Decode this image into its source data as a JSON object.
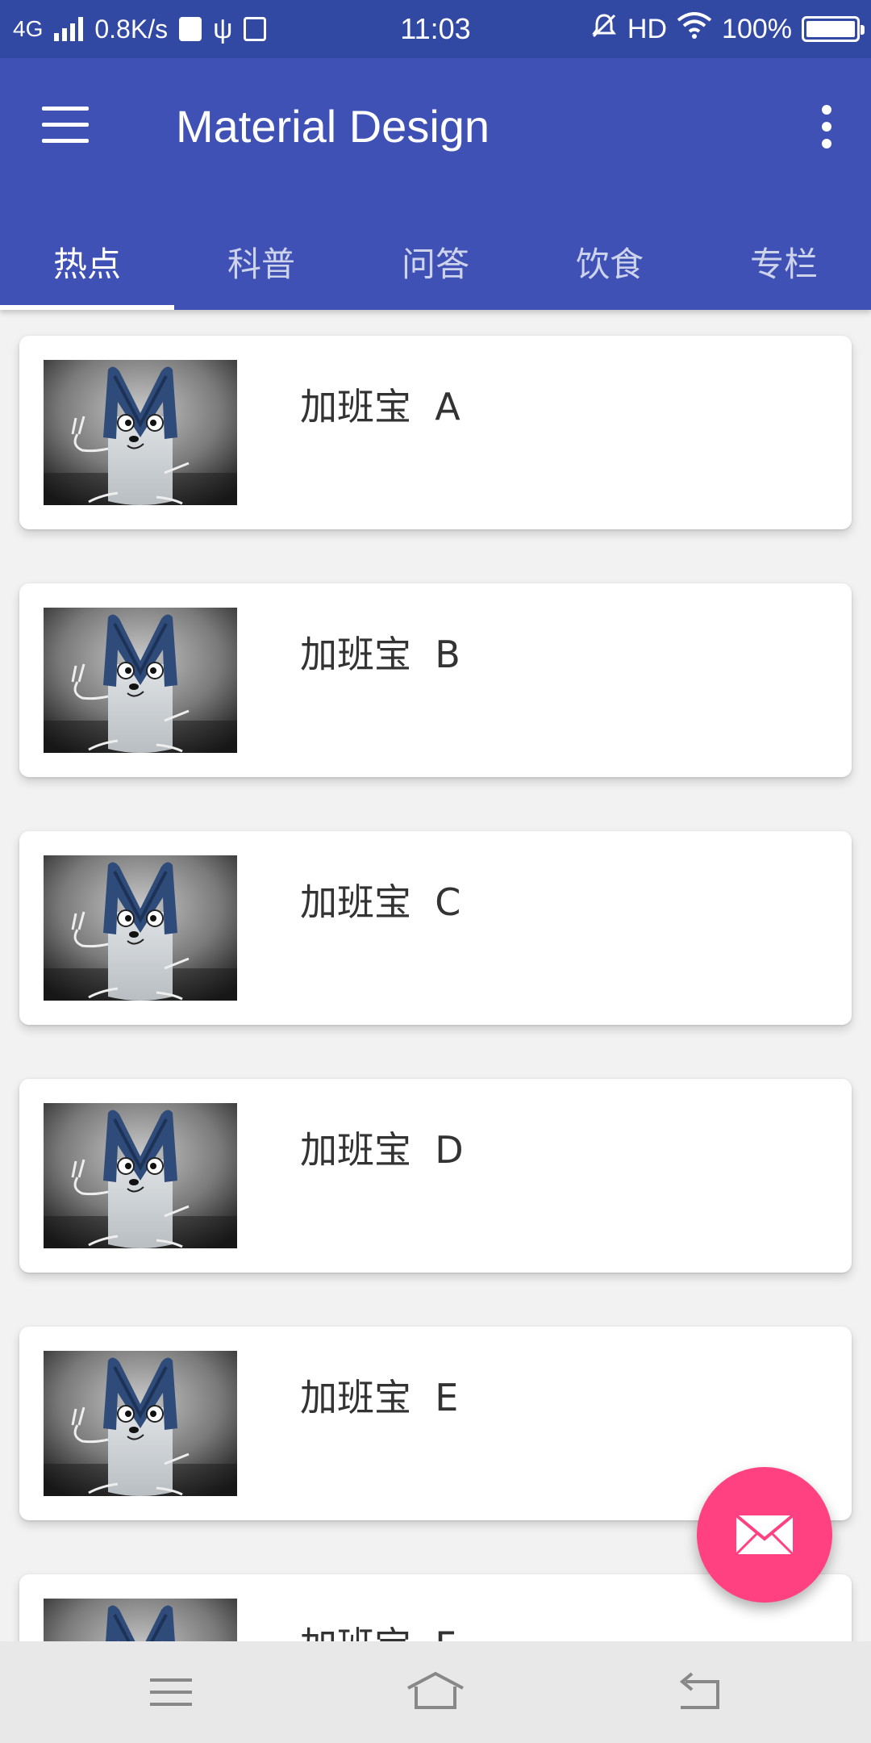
{
  "status_bar": {
    "network": "4G",
    "speed": "0.8K/s",
    "time": "11:03",
    "hd": "HD",
    "battery": "100%"
  },
  "app_bar": {
    "title": "Material Design",
    "menu_icon": "hamburger-menu-icon",
    "overflow_icon": "more-vert-icon",
    "color": "#3f51b5"
  },
  "tabs": [
    {
      "label": "热点",
      "active": true
    },
    {
      "label": "科普",
      "active": false
    },
    {
      "label": "问答",
      "active": false
    },
    {
      "label": "饮食",
      "active": false
    },
    {
      "label": "专栏",
      "active": false
    }
  ],
  "items": [
    {
      "title": "加班宝  A"
    },
    {
      "title": "加班宝  B"
    },
    {
      "title": "加班宝  C"
    },
    {
      "title": "加班宝  D"
    },
    {
      "title": "加班宝  E"
    },
    {
      "title": "加班宝  F"
    }
  ],
  "fab": {
    "icon": "mail-icon",
    "color": "#ff4081"
  },
  "nav_bar": {
    "icons": [
      "menu-icon",
      "home-icon",
      "back-icon"
    ]
  }
}
